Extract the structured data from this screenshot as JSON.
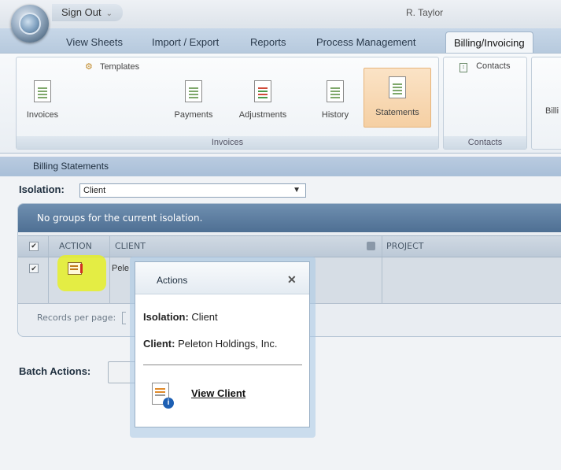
{
  "titlebar": {
    "signout_label": "Sign Out",
    "signout_chevron": "⌄",
    "username": "R. Taylor"
  },
  "tabs": [
    {
      "label": "View Sheets"
    },
    {
      "label": "Import / Export"
    },
    {
      "label": "Reports"
    },
    {
      "label": "Process Management"
    },
    {
      "label": "Billing/Invoicing",
      "active": true
    }
  ],
  "ribbon": {
    "templates_label": "Templates",
    "invoices_group": {
      "label": "Invoices",
      "buttons": [
        {
          "label": "Invoices",
          "icon": "invoice-doc-icon"
        },
        {
          "label": "Payments",
          "icon": "payments-doc-icon"
        },
        {
          "label": "Adjustments",
          "icon": "adjustments-doc-icon"
        },
        {
          "label": "History",
          "icon": "history-doc-icon"
        },
        {
          "label": "Statements",
          "icon": "statements-doc-icon",
          "selected": true
        }
      ]
    },
    "contacts_group": {
      "label": "Contacts",
      "button_label": "Contacts"
    },
    "cut_label": "Billi"
  },
  "section": {
    "title": "Billing Statements"
  },
  "isolation": {
    "label": "Isolation:",
    "value": "Client",
    "arrow": "▼"
  },
  "grid": {
    "group_message": "No groups for the current isolation.",
    "columns": {
      "check": "✔",
      "action": "ACTION",
      "client": "CLIENT",
      "project": "PROJECT"
    },
    "row": {
      "check": "✔",
      "client_partial": "Pele"
    },
    "footer": {
      "records_label": "Records per page:"
    }
  },
  "batch": {
    "label": "Batch Actions:"
  },
  "popup": {
    "title": "Actions",
    "close": "✕",
    "isolation_label": "Isolation:",
    "isolation_value": "Client",
    "client_label": "Client:",
    "client_value": "Peleton Holdings, Inc.",
    "view_client_label": "View Client",
    "info_badge": "i"
  },
  "colors": {
    "accent": "#4e6f93",
    "highlight": "#e6f028",
    "selected_button": "#f5cfa3"
  }
}
